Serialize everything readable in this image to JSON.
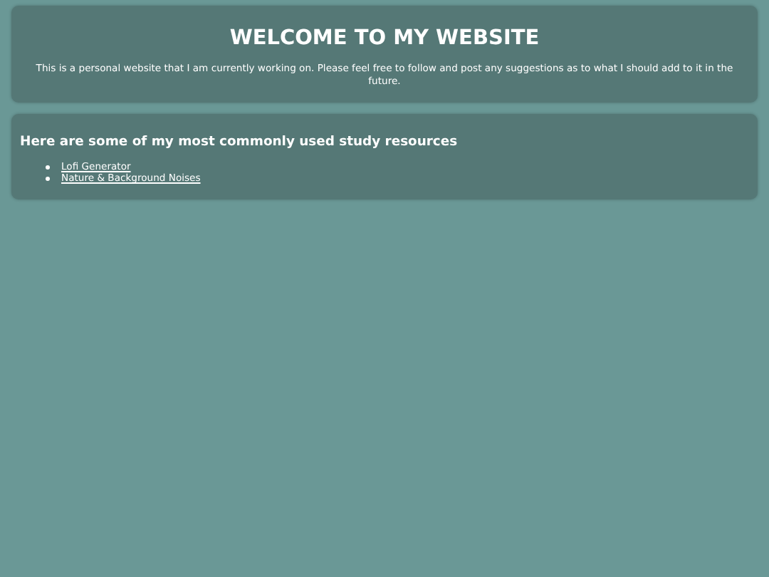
{
  "header": {
    "title": "WELCOME TO MY WEBSITE",
    "text": "This is a personal website that I am currently working on. Please feel free to follow and post any suggestions as to what I should add to it in the future."
  },
  "resources": {
    "heading": "Here are some of my most commonly used study resources",
    "links": [
      "Lofi Generator",
      "Nature & Background Noises"
    ]
  }
}
